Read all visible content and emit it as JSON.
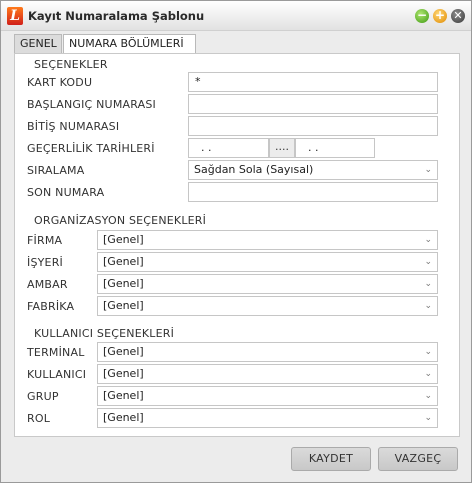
{
  "window": {
    "title": "Kayıt Numaralama Şablonu",
    "logo_letter": "L",
    "controls": {
      "minimize": "−",
      "maximize": "+",
      "close": "✕"
    }
  },
  "tabs": [
    {
      "label": "GENEL",
      "active": true
    },
    {
      "label": "NUMARA BÖLÜMLERİ",
      "active": false
    }
  ],
  "options": {
    "section_title": "SEÇENEKLER",
    "kart_kodu_label": "KART KODU",
    "kart_kodu_value": "*",
    "baslangic_label": "BAŞLANGIÇ NUMARASI",
    "baslangic_value": "",
    "bitis_label": "BİTİŞ NUMARASI",
    "bitis_value": "",
    "gecerlilik_label": "GEÇERLİLİK TARİHLERİ",
    "gecerlilik_start": ". .",
    "gecerlilik_button": "....",
    "gecerlilik_end": ". .",
    "siralama_label": "SIRALAMA",
    "siralama_value": "Sağdan Sola (Sayısal)",
    "son_numara_label": "SON NUMARA",
    "son_numara_value": ""
  },
  "organization": {
    "section_title": "ORGANİZASYON SEÇENEKLERİ",
    "firma_label": "FİRMA",
    "firma_value": "[Genel]",
    "isyeri_label": "İŞYERİ",
    "isyeri_value": "[Genel]",
    "ambar_label": "AMBAR",
    "ambar_value": "[Genel]",
    "fabrika_label": "FABRİKA",
    "fabrika_value": "[Genel]"
  },
  "user": {
    "section_title": "KULLANICI SEÇENEKLERİ",
    "terminal_label": "TERMİNAL",
    "terminal_value": "[Genel]",
    "kullanici_label": "KULLANICI",
    "kullanici_value": "[Genel]",
    "grup_label": "GRUP",
    "grup_value": "[Genel]",
    "rol_label": "ROL",
    "rol_value": "[Genel]"
  },
  "buttons": {
    "save": "KAYDET",
    "cancel": "VAZGEÇ"
  },
  "icons": {
    "dropdown": "chevron-down-icon",
    "chevron_glyph": "⌄"
  }
}
